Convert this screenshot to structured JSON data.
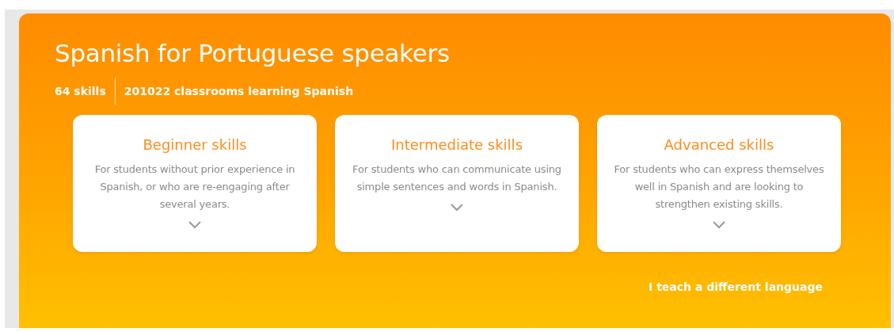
{
  "course": {
    "title": "Spanish for Portuguese speakers",
    "stats": [
      "64 skills",
      "201022 classrooms learning Spanish"
    ]
  },
  "levels": [
    {
      "title": "Beginner skills",
      "description": "For students without prior experience in Spanish, or who are re-engaging after several years."
    },
    {
      "title": "Intermediate skills",
      "description": "For students who can communicate using simple sentences and words in Spanish."
    },
    {
      "title": "Advanced skills",
      "description": "For students who can express themselves well in Spanish and are looking to strengthen existing skills."
    }
  ],
  "link": "I teach a different language"
}
